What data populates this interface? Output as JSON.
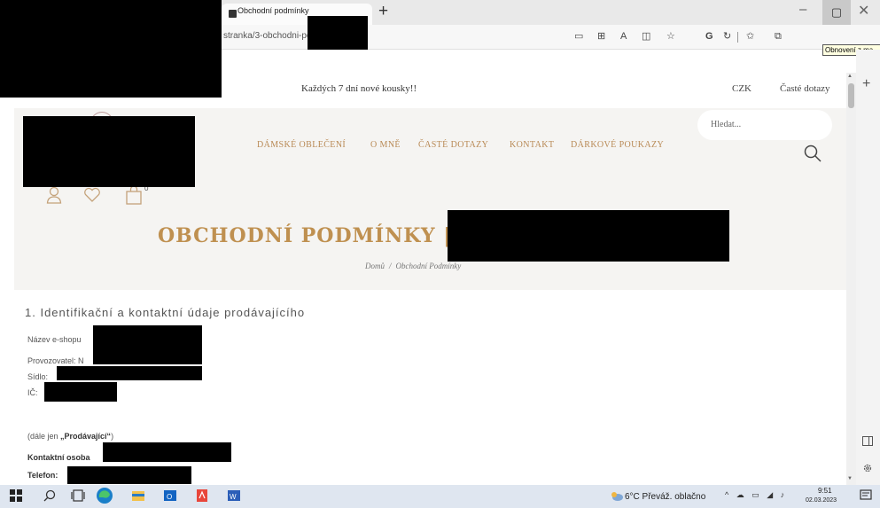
{
  "browser": {
    "tab_title": "Obchodní podmínky",
    "new_tab": "+",
    "url": "stranka/3-obchodni-podminky",
    "tooltip": "Obnovení z ma",
    "toolbar_icons": [
      "reader-view-icon",
      "apps-icon",
      "read-aloud-icon",
      "split-screen-icon",
      "favorite-add-icon",
      "grammarly-icon",
      "refresh-icon",
      "favorites-icon",
      "collections-icon"
    ],
    "minimize": "–",
    "restore": "▢",
    "close": "✕"
  },
  "site": {
    "announcement": "Každých 7 dní nové kousky!!",
    "currency": "CZK",
    "faq_link": "Časté dotazy",
    "search_placeholder": "Hledat...",
    "cart_count": "0",
    "nav": [
      "DÁMSKÉ OBLEČENÍ",
      "O MNĚ",
      "ČASTÉ DOTAZY",
      "KONTAKT",
      "DÁRKOVÉ POUKAZY"
    ],
    "page_title": "OBCHODNÍ PODMÍNKY |",
    "breadcrumb": {
      "home": "Domů",
      "separator": "/",
      "current": "Obchodní Podmínky"
    }
  },
  "content": {
    "section_heading": "1. Identifikační a kontaktní údaje prodávajícího",
    "fields": {
      "eshop_name": "Název e-shopu",
      "operator": "Provozovatel: N",
      "seat": "Sídlo:",
      "ico": "IČ:",
      "hereinafter_prefix": "(dále jen ",
      "hereinafter_bold": "„Prodávající“",
      "hereinafter_suffix": ")",
      "contact_person": "Kontaktní osoba",
      "phone": "Telefon:"
    }
  },
  "taskbar": {
    "weather": "6°C  Převáž. oblačno",
    "time": "9:51",
    "date": "02.03.2023",
    "apps": [
      "windows-start-icon",
      "search-icon",
      "task-view-icon",
      "edge-icon",
      "file-explorer-icon",
      "outlook-icon",
      "pdf-reader-icon",
      "word-icon"
    ]
  },
  "colors": {
    "accent_gold": "#bf9050",
    "nav_gold": "#b98a56",
    "header_bg": "#f5f4f2"
  }
}
